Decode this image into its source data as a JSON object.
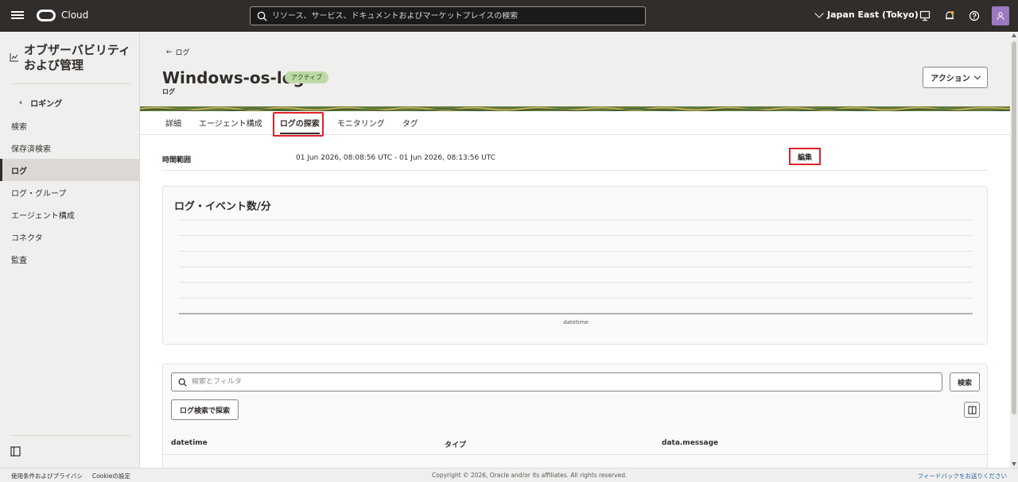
{
  "topbar": {
    "brand": "Cloud",
    "search_placeholder": "リソース、サービス、ドキュメントおよびマーケットプレイスの検索",
    "region": "Japan East (Tokyo)"
  },
  "sidebar": {
    "title": "オブザーバビリティおよび管理",
    "back_label": "ロギング",
    "items": [
      {
        "label": "検索"
      },
      {
        "label": "保存済検索"
      },
      {
        "label": "ログ"
      },
      {
        "label": "ログ・グループ"
      },
      {
        "label": "エージェント構成"
      },
      {
        "label": "コネクタ"
      },
      {
        "label": "監査"
      }
    ]
  },
  "header": {
    "back_link": "ログ",
    "title": "Windows-os-log",
    "status": "アクティブ",
    "subtitle": "ログ",
    "action_label": "アクション"
  },
  "tabs": [
    {
      "label": "詳細"
    },
    {
      "label": "エージェント構成"
    },
    {
      "label": "ログの探索"
    },
    {
      "label": "モニタリング"
    },
    {
      "label": "タグ"
    }
  ],
  "time_range": {
    "label": "時間範囲",
    "value": "01 Jun 2026, 08:08:56 UTC - 01 Jun 2026, 08:13:56 UTC",
    "edit_label": "編集"
  },
  "chart_data": {
    "type": "line",
    "title": "ログ・イベント数/分",
    "xlabel": "datetime",
    "ylabel": "",
    "series": [],
    "grid": true
  },
  "log_table": {
    "filter_placeholder": "検索とフィルタ",
    "search_label": "検索",
    "explore_label": "ログ検索で探索",
    "columns": [
      "datetime",
      "タイプ",
      "data.message"
    ]
  },
  "footer": {
    "terms": "使用条件およびプライバシ",
    "cookies": "Cookieの設定",
    "copyright": "Copyright © 2026, Oracle and/or its affiliates. All rights reserved.",
    "feedback": "フィードバックをお送りください"
  },
  "colors": {
    "topbar": "#312d2a",
    "highlight": "#e0202a",
    "badge": "#bcd9a6",
    "link": "#2166a8"
  }
}
